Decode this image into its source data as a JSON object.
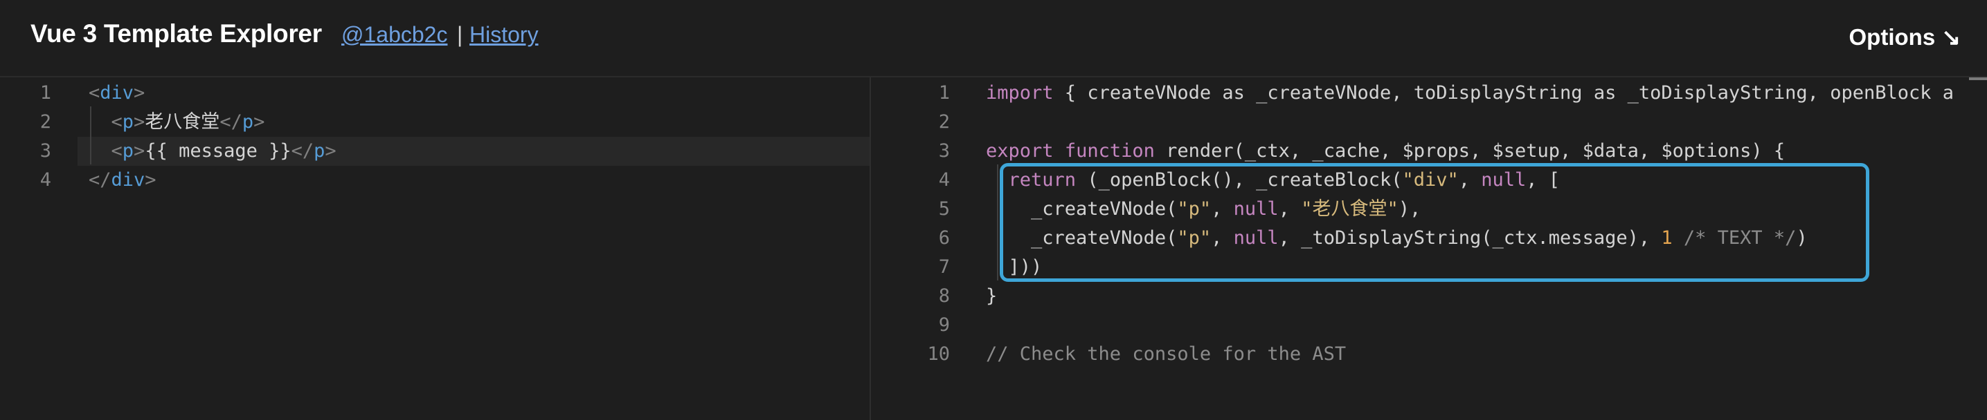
{
  "header": {
    "title": "Vue 3 Template Explorer",
    "commit_link": "@1abcb2c",
    "separator": "|",
    "history_link": "History",
    "options_label": "Options ↘"
  },
  "template_editor": {
    "line_numbers": [
      "1",
      "2",
      "3",
      "4"
    ],
    "lines": [
      [
        {
          "t": "<",
          "c": "bracket"
        },
        {
          "t": "div",
          "c": "tag"
        },
        {
          "t": ">",
          "c": "bracket"
        }
      ],
      [
        {
          "t": "  "
        },
        {
          "t": "<",
          "c": "bracket"
        },
        {
          "t": "p",
          "c": "tag"
        },
        {
          "t": ">",
          "c": "bracket"
        },
        {
          "t": "老八食堂",
          "c": "txt"
        },
        {
          "t": "</",
          "c": "bracket"
        },
        {
          "t": "p",
          "c": "tag"
        },
        {
          "t": ">",
          "c": "bracket"
        }
      ],
      [
        {
          "t": "  "
        },
        {
          "t": "<",
          "c": "bracket"
        },
        {
          "t": "p",
          "c": "tag"
        },
        {
          "t": ">",
          "c": "bracket"
        },
        {
          "t": "{{ message }}",
          "c": "txt"
        },
        {
          "t": "</",
          "c": "bracket"
        },
        {
          "t": "p",
          "c": "tag"
        },
        {
          "t": ">",
          "c": "bracket"
        }
      ],
      [
        {
          "t": "</",
          "c": "bracket"
        },
        {
          "t": "div",
          "c": "tag"
        },
        {
          "t": ">",
          "c": "bracket"
        }
      ]
    ]
  },
  "output_editor": {
    "line_numbers": [
      "1",
      "2",
      "3",
      "4",
      "5",
      "6",
      "7",
      "8",
      "9",
      "10"
    ],
    "lines": [
      [
        {
          "t": "import",
          "c": "kw"
        },
        {
          "t": " { createVNode ",
          "c": "pl"
        },
        {
          "t": "as",
          "c": "pl"
        },
        {
          "t": " _createVNode, toDisplayString ",
          "c": "pl"
        },
        {
          "t": "as",
          "c": "pl"
        },
        {
          "t": " _toDisplayString, openBlock ",
          "c": "pl"
        },
        {
          "t": "a",
          "c": "pl"
        }
      ],
      [],
      [
        {
          "t": "export",
          "c": "kw"
        },
        {
          "t": " ",
          "c": "pl"
        },
        {
          "t": "function",
          "c": "kw"
        },
        {
          "t": " render(_ctx, _cache, $props, $setup, $data, $options) {",
          "c": "pl"
        }
      ],
      [
        {
          "t": "  "
        },
        {
          "t": "return",
          "c": "kw"
        },
        {
          "t": " (_openBlock(), _createBlock(",
          "c": "pl"
        },
        {
          "t": "\"div\"",
          "c": "strg"
        },
        {
          "t": ", ",
          "c": "pl"
        },
        {
          "t": "null",
          "c": "nullk"
        },
        {
          "t": ", [",
          "c": "pl"
        }
      ],
      [
        {
          "t": "    _createVNode(",
          "c": "pl"
        },
        {
          "t": "\"p\"",
          "c": "strg"
        },
        {
          "t": ", ",
          "c": "pl"
        },
        {
          "t": "null",
          "c": "nullk"
        },
        {
          "t": ", ",
          "c": "pl"
        },
        {
          "t": "\"老八食堂\"",
          "c": "strg"
        },
        {
          "t": "),",
          "c": "pl"
        }
      ],
      [
        {
          "t": "    _createVNode(",
          "c": "pl"
        },
        {
          "t": "\"p\"",
          "c": "strg"
        },
        {
          "t": ", ",
          "c": "pl"
        },
        {
          "t": "null",
          "c": "nullk"
        },
        {
          "t": ", _toDisplayString(_ctx.message), ",
          "c": "pl"
        },
        {
          "t": "1",
          "c": "numo"
        },
        {
          "t": " /* TEXT */",
          "c": "cmtg"
        },
        {
          "t": ")",
          "c": "pl"
        }
      ],
      [
        {
          "t": "  ]))",
          "c": "pl"
        }
      ],
      [
        {
          "t": "}",
          "c": "pl"
        }
      ],
      [],
      [
        {
          "t": "// Check the console for the AST",
          "c": "cmtg"
        }
      ]
    ]
  }
}
